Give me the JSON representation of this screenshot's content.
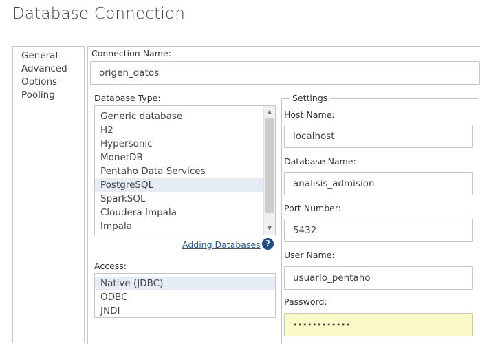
{
  "page": {
    "title": "Database Connection"
  },
  "nav": {
    "items": [
      {
        "label": "General"
      },
      {
        "label": "Advanced"
      },
      {
        "label": "Options"
      },
      {
        "label": "Pooling"
      }
    ],
    "selected": "General"
  },
  "connection_name": {
    "label": "Connection Name:",
    "value": "origen_datos"
  },
  "database_type": {
    "label": "Database Type:",
    "items": [
      "Generic database",
      "H2",
      "Hypersonic",
      "MonetDB",
      "Pentaho Data Services",
      "PostgreSQL",
      "SparkSQL",
      "Cloudera Impala",
      "Impala"
    ],
    "selected": "PostgreSQL",
    "help_link": "Adding Databases",
    "help_icon": "help-icon"
  },
  "access": {
    "label": "Access:",
    "items": [
      "Native (JDBC)",
      "ODBC",
      "JNDI"
    ],
    "selected": "Native (JDBC)"
  },
  "settings": {
    "legend": "Settings",
    "host_name": {
      "label": "Host Name:",
      "value": "localhost"
    },
    "database_name": {
      "label": "Database Name:",
      "value": "analisis_admision"
    },
    "port_number": {
      "label": "Port Number:",
      "value": "5432"
    },
    "user_name": {
      "label": "User Name:",
      "value": "usuario_pentaho"
    },
    "password": {
      "label": "Password:",
      "value": "••••••••••••"
    }
  },
  "colors": {
    "selection": "#e6ecf3",
    "password_bg": "#fbfbc8",
    "link": "#1f5fa8",
    "help_icon": "#1d4e89"
  }
}
